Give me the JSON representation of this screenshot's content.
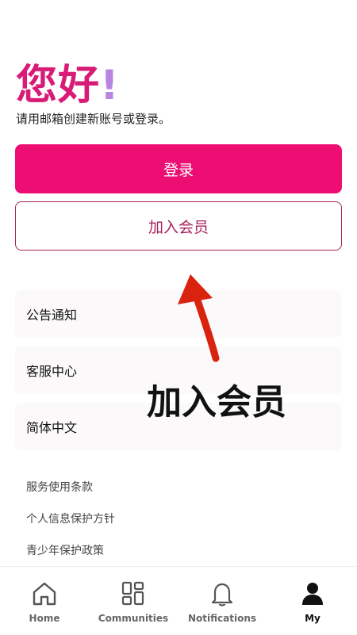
{
  "header": {
    "greeting": "您好",
    "greeting_punct": "!",
    "subtitle": "请用邮箱创建新账号或登录。"
  },
  "actions": {
    "login_label": "登录",
    "join_label": "加入会员"
  },
  "menu": {
    "items": [
      {
        "label": "公告通知"
      },
      {
        "label": "客服中心"
      },
      {
        "label": "简体中文"
      }
    ]
  },
  "links": [
    {
      "label": "服务使用条款"
    },
    {
      "label": "个人信息保护方针"
    },
    {
      "label": "青少年保护政策"
    }
  ],
  "annotation": {
    "text": "加入会员",
    "arrow_color": "#d9230f"
  },
  "tabbar": {
    "tabs": [
      {
        "label": "Home",
        "icon": "home-icon"
      },
      {
        "label": "Communities",
        "icon": "grid-icon"
      },
      {
        "label": "Notifications",
        "icon": "bell-icon"
      },
      {
        "label": "My",
        "icon": "user-icon",
        "active": true
      }
    ]
  },
  "colors": {
    "brand": "#ec0e72",
    "greeting": "#d81b77",
    "join_border": "#a8225e"
  }
}
